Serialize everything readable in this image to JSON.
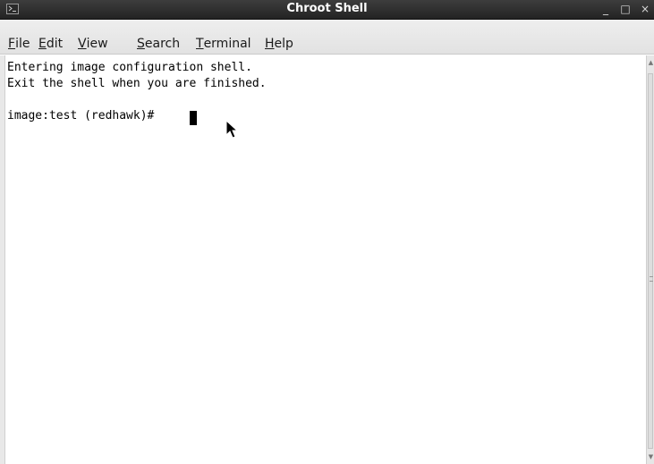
{
  "window": {
    "title": "Chroot Shell",
    "controls": {
      "minimize": "_",
      "maximize": "□",
      "close": "×"
    },
    "app_icon": "terminal-icon"
  },
  "menubar": {
    "items": [
      {
        "mnemonic": "F",
        "rest": "ile"
      },
      {
        "mnemonic": "E",
        "rest": "dit"
      },
      {
        "mnemonic": "V",
        "rest": "iew"
      },
      {
        "mnemonic": "S",
        "rest": "earch"
      },
      {
        "mnemonic": "T",
        "rest": "erminal"
      },
      {
        "mnemonic": "H",
        "rest": "elp"
      }
    ]
  },
  "terminal": {
    "lines": [
      "Entering image configuration shell.",
      "Exit the shell when you are finished.",
      "image:test (redhawk)# "
    ],
    "background": "#ffffff",
    "foreground": "#000000"
  },
  "scrollbar": {
    "up": "▲",
    "down": "▼"
  }
}
